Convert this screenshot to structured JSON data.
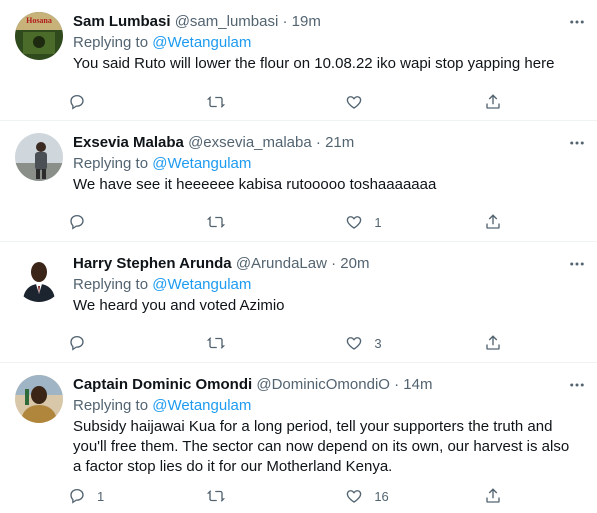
{
  "tweets": [
    {
      "name": "Sam Lumbasi",
      "handle": "@sam_lumbasi",
      "sep": "·",
      "time": "19m",
      "replying_prefix": "Replying to",
      "replying_to": "@Wetangulam",
      "text": "You said Ruto will lower the flour on 10.08.22 iko wapi stop yapping here",
      "reply_count": "",
      "retweet_count": "",
      "like_count": ""
    },
    {
      "name": "Exsevia Malaba",
      "handle": "@exsevia_malaba",
      "sep": "·",
      "time": "21m",
      "replying_prefix": "Replying to",
      "replying_to": "@Wetangulam",
      "text": "We have see it heeeeee kabisa rutooooo toshaaaaaaa",
      "reply_count": "",
      "retweet_count": "",
      "like_count": "1"
    },
    {
      "name": "Harry Stephen Arunda",
      "handle": "@ArundaLaw",
      "sep": "·",
      "time": "20m",
      "replying_prefix": "Replying to",
      "replying_to": "@Wetangulam",
      "text": "We heard you and voted Azimio",
      "reply_count": "",
      "retweet_count": "",
      "like_count": "3"
    },
    {
      "name": "Captain Dominic Omondi",
      "handle": "@DominicOmondiO",
      "sep": "·",
      "time": "14m",
      "replying_prefix": "Replying to",
      "replying_to": "@Wetangulam",
      "text": "Subsidy haijawai Kua for a long period, tell your supporters the truth and you'll free them. The sector can now depend on its own, our harvest is also a factor stop lies do it for our Motherland Kenya.",
      "reply_count": "1",
      "retweet_count": "",
      "like_count": "16"
    }
  ],
  "icons": {
    "more": "more-horizontal-icon",
    "reply": "reply-icon",
    "retweet": "retweet-icon",
    "like": "heart-icon",
    "share": "share-icon"
  },
  "colors": {
    "link": "#1d9bf0",
    "secondary_text": "#536471",
    "primary_text": "#0f1419",
    "divider": "#eff3f4"
  }
}
